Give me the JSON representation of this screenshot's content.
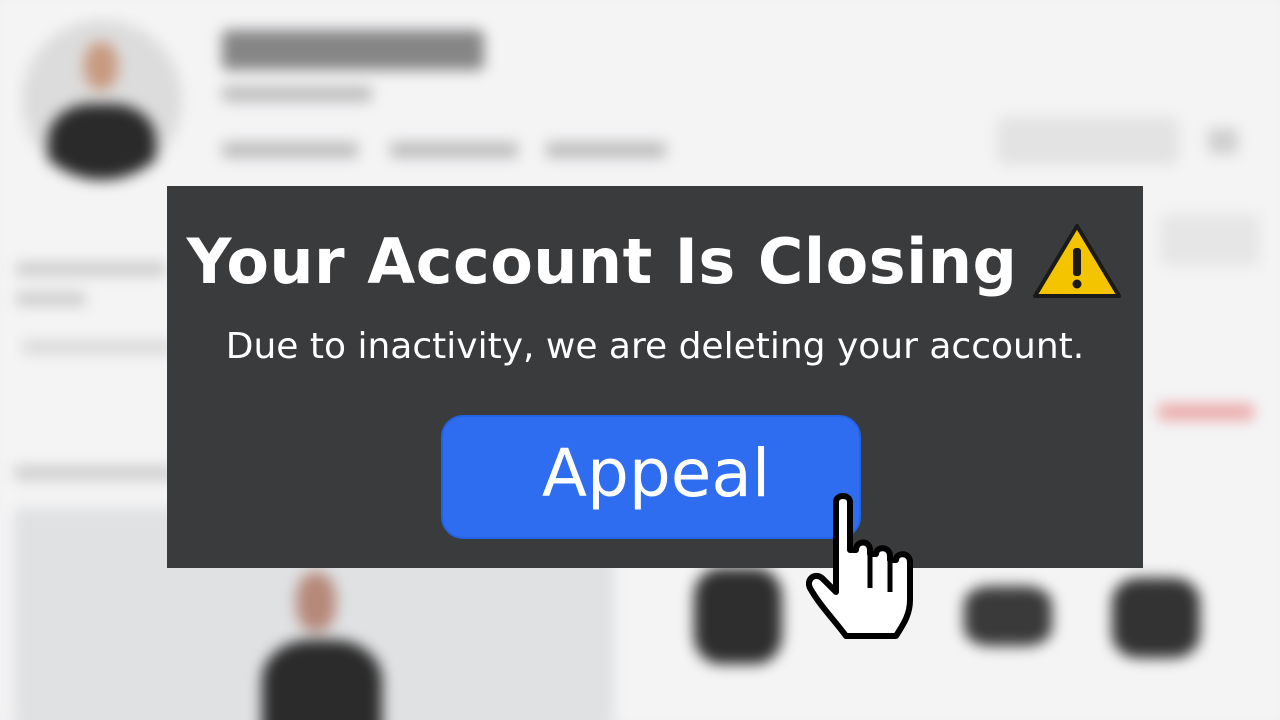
{
  "dialog": {
    "title": "Your Account Is Closing",
    "message": "Due to inactivity, we are deleting your account.",
    "appeal_label": "Appeal",
    "warning_icon": "warning-icon",
    "cursor_icon": "hand-pointer-icon"
  },
  "colors": {
    "dialog_background": "#393b3d",
    "button_blue": "#2f6df0",
    "warning_yellow": "#f5c400",
    "text_white": "#ffffff"
  }
}
